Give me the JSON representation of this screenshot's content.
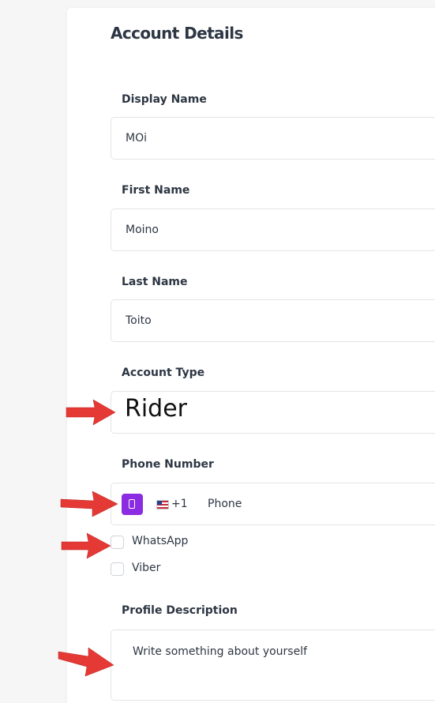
{
  "section_title": "Account Details",
  "fields": {
    "display_name": {
      "label": "Display Name",
      "value": "MOi"
    },
    "first_name": {
      "label": "First Name",
      "value": "Moino"
    },
    "last_name": {
      "label": "Last Name",
      "value": "Toito"
    },
    "account_type": {
      "label": "Account Type",
      "value": "Rider"
    }
  },
  "phone": {
    "label": "Phone Number",
    "country_code": "+1",
    "placeholder": "Phone",
    "icon": "mobile-phone-icon",
    "flag_icon": "us-flag-icon"
  },
  "checkboxes": [
    {
      "label": "WhatsApp",
      "checked": false
    },
    {
      "label": "Viber",
      "checked": false
    }
  ],
  "profile_description": {
    "label": "Profile Description",
    "placeholder": "Write something about yourself"
  },
  "colors": {
    "accent": "#8b2be2",
    "annotation_arrow": "#e53935"
  }
}
